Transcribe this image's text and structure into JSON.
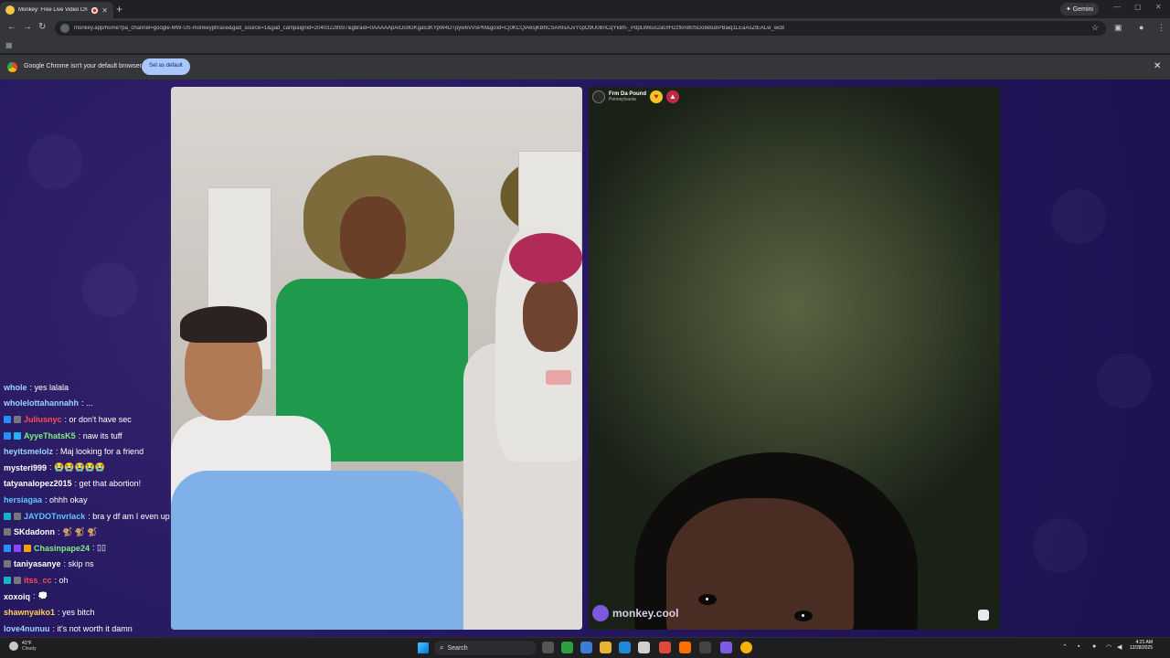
{
  "browser": {
    "tab_title": "Monkey: Free Live Video Ch",
    "tab_close": "✕",
    "new_tab": "+",
    "gemini_label": "✦ Gemini",
    "url": "monkey.app/home?pa_channel=google-MW-US-monkeyphrase&gad_source=1&gad_campaignid=20403228937&gbraid=0AAAAApAlOo9GKga53KYpW4DTpyw6VvSPM&gclid=Cj0KCQiA6sjKBhCSARIsAJvYcpO9U0BnCqYkBh-_PdpLWkus2aGfH2zfkm80SDo8etu8PBaiq1LEaAsZtEALw_wcB",
    "infobar_message": "Google Chrome isn't your default browser",
    "infobar_button": "Set as default",
    "infobar_close": "✕"
  },
  "remote_user": {
    "name": "Frm Da Pound",
    "location": "Pennsylvania"
  },
  "watermark": "monkey.cool",
  "chat": [
    {
      "user": "whole",
      "text": ": yes lalala",
      "color": "#9fd3ff",
      "badges": []
    },
    {
      "user": "wholelottahannahh",
      "text": ": ...",
      "color": "#9fd3ff",
      "badges": []
    },
    {
      "user": "Juliusnyc",
      "text": ": or don't have sec",
      "color": "#ff4d4d",
      "badges": [
        "#2b8cff",
        "#777"
      ]
    },
    {
      "user": "AyyeThatsK5",
      "text": ": naw its tuff",
      "color": "#7df07d",
      "badges": [
        "#2b8cff",
        "#1fb3ff"
      ]
    },
    {
      "user": "heyitsmelolz",
      "text": ": Maj looking for a friend",
      "color": "#9fd3ff",
      "badges": []
    },
    {
      "user": "mysteri999",
      "text": ": 😭😭😭😭😭",
      "color": "#ffffff",
      "badges": []
    },
    {
      "user": "tatyanalopez2015",
      "text": ": get that abortion!",
      "color": "#ffffff",
      "badges": []
    },
    {
      "user": "hersiagaa",
      "text": ": ohhh okay",
      "color": "#5ec8ff",
      "badges": []
    },
    {
      "user": "JAYDOTnvrlack",
      "text": ": bra y df am I even up",
      "color": "#5ec8ff",
      "badges": [
        "#17b3c4",
        "#777"
      ]
    },
    {
      "user": "SKdadonn",
      "text": ": 🐒 🐒 🐒",
      "color": "#ffffff",
      "badges": [
        "#777"
      ]
    },
    {
      "user": "Chasinpape24",
      "text": ": ▯▯",
      "color": "#7df07d",
      "badges": [
        "#2b8cff",
        "#8b44ff",
        "#f4a100"
      ]
    },
    {
      "user": "taniyasanye",
      "text": ": skip ns",
      "color": "#ffffff",
      "badges": [
        "#777"
      ]
    },
    {
      "user": "itss_cc",
      "text": ": oh",
      "color": "#ff4d4d",
      "badges": [
        "#17b3c4",
        "#777"
      ]
    },
    {
      "user": "xoxoiq",
      "text": ": 💭",
      "color": "#ffffff",
      "badges": []
    },
    {
      "user": "shawnyaiko1",
      "text": ": yes bitch",
      "color": "#ffd34d",
      "badges": []
    },
    {
      "user": "love4nunuu",
      "text": ": it's not worth it damn",
      "color": "#9fd3ff",
      "badges": []
    }
  ],
  "taskbar": {
    "weather_temp": "41°F",
    "weather_desc": "Cloudy",
    "search_label": "Search",
    "time": "4:21 AM",
    "date": "12/28/2025"
  },
  "colors": {
    "page_bg": "#251861",
    "chrome_dark": "#202124",
    "chrome_mid": "#35363a",
    "set_default_btn": "#a8c7fa"
  }
}
